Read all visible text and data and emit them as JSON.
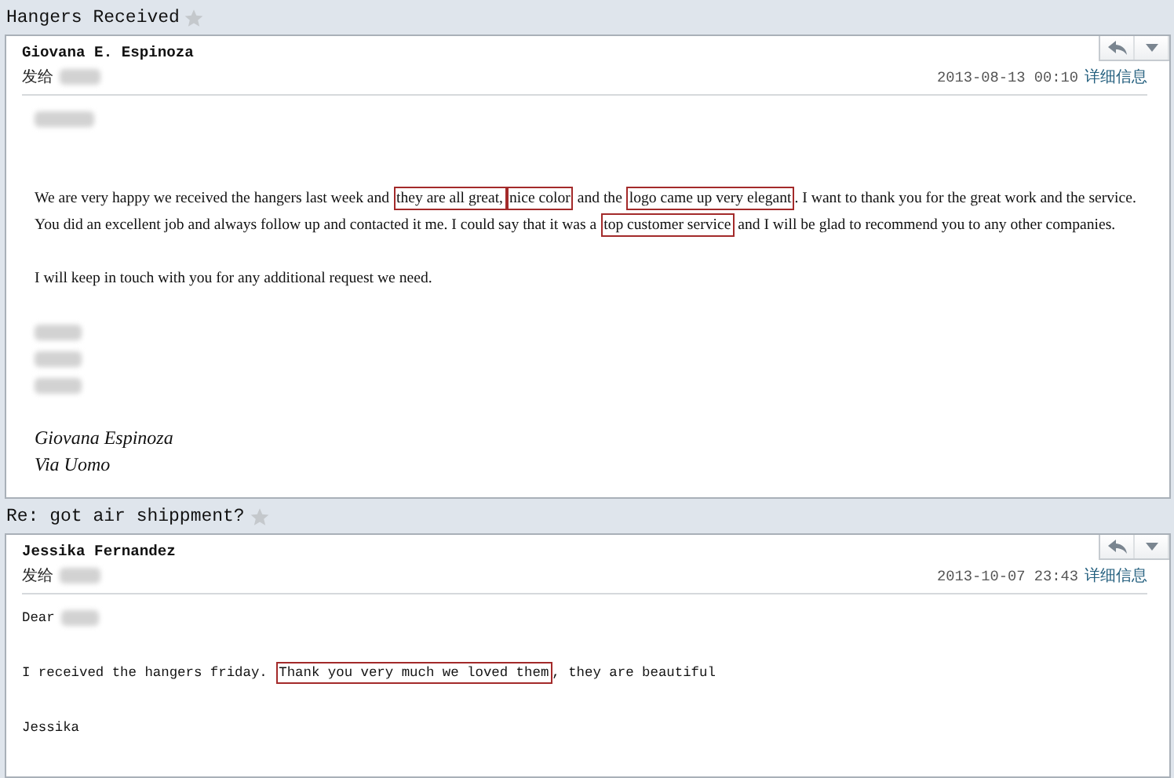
{
  "emails": [
    {
      "subject": "Hangers Received",
      "starred": false,
      "sender": "Giovana E. Espinoza",
      "to_label": "发给",
      "date": "2013-08-13 00:10",
      "details_link": "详细信息",
      "kind": "serif",
      "lines": [
        {
          "kind": "redacted"
        },
        {
          "kind": "blank"
        },
        {
          "kind": "blank"
        },
        {
          "kind": "text",
          "segments": [
            {
              "text": "We are very happy we received the hangers last week and ",
              "highlighted": false
            },
            {
              "text": "they are all great,",
              "highlighted": true
            },
            {
              "text": "nice color",
              "highlighted": true
            },
            {
              "text": " and the ",
              "highlighted": false
            },
            {
              "text": "logo came up very elegant",
              "highlighted": true
            },
            {
              "text": ". I want to thank you for the great work and the service.",
              "highlighted": false
            }
          ]
        },
        {
          "kind": "text",
          "segments": [
            {
              "text": "You did an excellent job and always follow up and contacted it me. I could say that it was a ",
              "highlighted": false
            },
            {
              "text": "top customer service",
              "highlighted": true
            },
            {
              "text": " and I will be glad to recommend you to any other companies.",
              "highlighted": false
            }
          ]
        },
        {
          "kind": "blank"
        },
        {
          "kind": "text",
          "segments": [
            {
              "text": "I will keep in touch with you for any additional request we need.",
              "highlighted": false
            }
          ]
        },
        {
          "kind": "blank"
        },
        {
          "kind": "redacted"
        },
        {
          "kind": "redacted"
        },
        {
          "kind": "redacted"
        },
        {
          "kind": "blank"
        },
        {
          "kind": "italic",
          "segments": [
            {
              "text": "Giovana Espinoza",
              "highlighted": false
            }
          ]
        },
        {
          "kind": "italic",
          "segments": [
            {
              "text": "Via Uomo",
              "highlighted": false
            }
          ]
        }
      ]
    },
    {
      "subject": "Re: got air shippment?",
      "starred": false,
      "sender": "Jessika Fernandez",
      "to_label": "发给",
      "date": "2013-10-07 23:43",
      "details_link": "详细信息",
      "kind": "mono",
      "lines": [
        {
          "kind": "greeting",
          "segments": [
            {
              "text": "Dear",
              "highlighted": false
            }
          ]
        },
        {
          "kind": "blank"
        },
        {
          "kind": "text",
          "segments": [
            {
              "text": "I received the hangers friday. ",
              "highlighted": false
            },
            {
              "text": "Thank you very much we loved them",
              "highlighted": true
            },
            {
              "text": ", they are beautiful",
              "highlighted": false
            }
          ]
        },
        {
          "kind": "blank"
        },
        {
          "kind": "text",
          "segments": [
            {
              "text": "Jessika",
              "highlighted": false
            }
          ]
        }
      ]
    }
  ]
}
